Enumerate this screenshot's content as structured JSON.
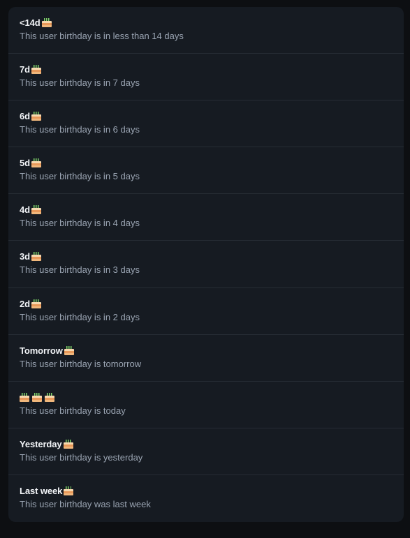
{
  "icon": "birthday-cake-icon",
  "rows": [
    {
      "label": "<14d",
      "cakes": 1,
      "description": "This user birthday is in less than 14 days"
    },
    {
      "label": "7d",
      "cakes": 1,
      "description": "This user birthday is in 7 days"
    },
    {
      "label": "6d",
      "cakes": 1,
      "description": "This user birthday is in 6 days"
    },
    {
      "label": "5d",
      "cakes": 1,
      "description": "This user birthday is in 5 days"
    },
    {
      "label": "4d",
      "cakes": 1,
      "description": "This user birthday is in 4 days"
    },
    {
      "label": "3d",
      "cakes": 1,
      "description": "This user birthday is in 3 days"
    },
    {
      "label": "2d",
      "cakes": 1,
      "description": "This user birthday is in 2 days"
    },
    {
      "label": "Tomorrow",
      "cakes": 1,
      "description": "This user birthday is tomorrow"
    },
    {
      "label": "",
      "cakes": 3,
      "description": "This user birthday is today"
    },
    {
      "label": "Yesterday",
      "cakes": 1,
      "description": "This user birthday is yesterday"
    },
    {
      "label": "Last week",
      "cakes": 1,
      "description": "This user birthday was last week"
    }
  ]
}
